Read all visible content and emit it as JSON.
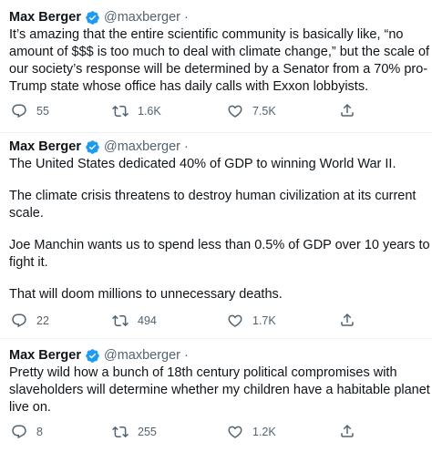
{
  "tweets": [
    {
      "name": "Max Berger",
      "handle": "@maxberger",
      "separator": "·",
      "lines": [
        "It’s amazing that the entire scientific community is basically like, “no",
        "amount of $$$ is too much to deal with climate change,” but the scale of",
        "our society’s response will be determined by a Senator from a 70% pro-",
        "Trump state whose office has daily calls with Exxon lobbyists."
      ],
      "replies": "55",
      "retweets": "1.6K",
      "likes": "7.5K"
    },
    {
      "name": "Max Berger",
      "handle": "@maxberger",
      "separator": "·",
      "paragraphs": [
        [
          "The United States dedicated 40% of GDP to winning World War II."
        ],
        [
          "The climate crisis threatens to destroy human civilization at its current",
          "scale."
        ],
        [
          "Joe Manchin wants us to spend less than 0.5% of GDP over 10 years to",
          "fight it."
        ],
        [
          "That will doom millions to unnecessary deaths."
        ]
      ],
      "replies": "22",
      "retweets": "494",
      "likes": "1.7K"
    },
    {
      "name": "Max Berger",
      "handle": "@maxberger",
      "separator": "·",
      "lines": [
        "Pretty wild how a bunch of 18th century political compromises with",
        "slaveholders will determine whether my children have a habitable planet to",
        "live on."
      ],
      "replies": "8",
      "retweets": "255",
      "likes": "1.2K"
    }
  ],
  "icons": {
    "verified": "verified-badge-icon",
    "reply": "reply-icon",
    "retweet": "retweet-icon",
    "like": "heart-icon",
    "share": "share-icon"
  },
  "colors": {
    "text": "#0f1419",
    "secondary": "#536471",
    "verified": "#1d9bf0",
    "divider": "#eff3f4"
  }
}
